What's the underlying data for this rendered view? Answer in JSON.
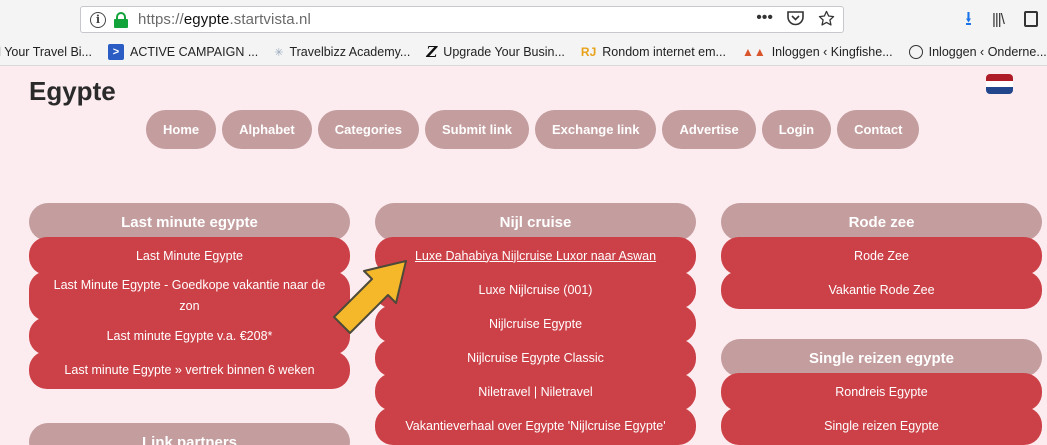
{
  "browser": {
    "url_prefix": "https://",
    "url_domain": "egypte",
    "url_rest": ".startvista.nl",
    "page_actions": "•••",
    "bookmarks": [
      {
        "label": "d Your Travel Bi...",
        "icon": "none"
      },
      {
        "label": "ACTIVE CAMPAIGN ...",
        "icon": "activecampaign-icon"
      },
      {
        "label": "Travelbizz Academy...",
        "icon": "leaf-icon"
      },
      {
        "label": "Upgrade Your Busin...",
        "icon": "z-icon"
      },
      {
        "label": "Rondom internet em...",
        "icon": "rj-icon"
      },
      {
        "label": "Inloggen ‹ Kingfishe...",
        "icon": "kingfisher-icon"
      },
      {
        "label": "Inloggen ‹ Onderne...",
        "icon": "globe-icon"
      }
    ]
  },
  "site": {
    "title": "Egypte",
    "flag": {
      "colors": [
        "#ae1c28",
        "#ffffff",
        "#21468b"
      ]
    }
  },
  "nav": [
    "Home",
    "Alphabet",
    "Categories",
    "Submit link",
    "Exchange link",
    "Advertise",
    "Login",
    "Contact"
  ],
  "columns": {
    "last_minute": {
      "header": "Last minute egypte",
      "items": [
        "Last Minute Egypte",
        "Last Minute Egypte - Goedkope vakantie naar de zon",
        "Last minute Egypte v.a. €208*",
        "Last minute Egypte » vertrek binnen 6 weken"
      ]
    },
    "link_partners": {
      "header": "Link partners"
    },
    "nijl_cruise": {
      "header": "Nijl cruise",
      "items": [
        "Luxe Dahabiya Nijlcruise Luxor naar Aswan",
        "Luxe Nijlcruise (001)",
        "Nijlcruise Egypte",
        "Nijlcruise Egypte Classic",
        "Niletravel | Niletravel",
        "Vakantieverhaal over Egypte 'Nijlcruise Egypte'"
      ]
    },
    "rode_zee": {
      "header": "Rode zee",
      "items": [
        "Rode Zee",
        "Vakantie Rode Zee"
      ]
    },
    "single_reizen": {
      "header": "Single reizen egypte",
      "items": [
        "Rondreis Egypte",
        "Single reizen Egypte"
      ]
    }
  },
  "colors": {
    "header_bg": "#c49d9e",
    "item_bg": "#cc4047",
    "page_bg": "#fcebef",
    "arrow": "#f4b82a"
  }
}
